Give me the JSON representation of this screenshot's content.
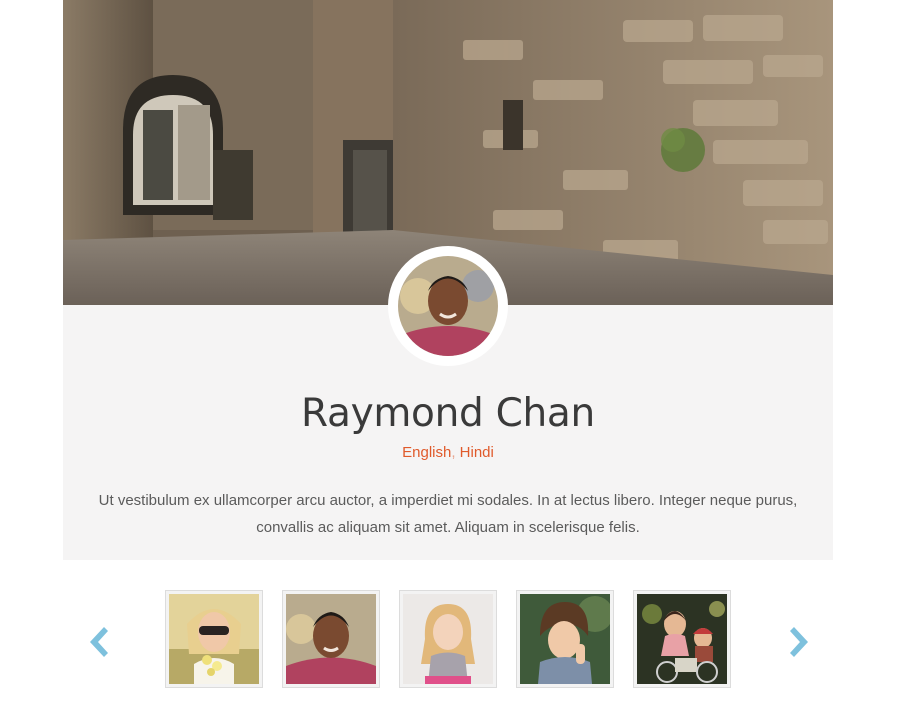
{
  "profile": {
    "name": "Raymond Chan",
    "languages": [
      "English",
      "Hindi"
    ],
    "language_separator": ",",
    "bio": "Ut vestibulum ex ullamcorper arcu auctor, a imperdiet mi sodales. In at lectus libero. Integer neque purus, convallis ac aliquam sit amet. Aliquam in scelerisque felis."
  },
  "carousel": {
    "prev_icon": "chevron-left-icon",
    "next_icon": "chevron-right-icon",
    "thumbnails": [
      {
        "subject": "woman-with-sunglasses-and-flowers"
      },
      {
        "subject": "smiling-boy"
      },
      {
        "subject": "blonde-girl-in-dress"
      },
      {
        "subject": "curly-haired-child"
      },
      {
        "subject": "children-on-bicycle"
      }
    ]
  },
  "colors": {
    "accent_orange": "#e05a2b",
    "arrow_blue": "#7ec1dd",
    "card_background": "#f5f4f4",
    "name_text": "#3a3a3a",
    "body_text": "#5b5b5b"
  }
}
